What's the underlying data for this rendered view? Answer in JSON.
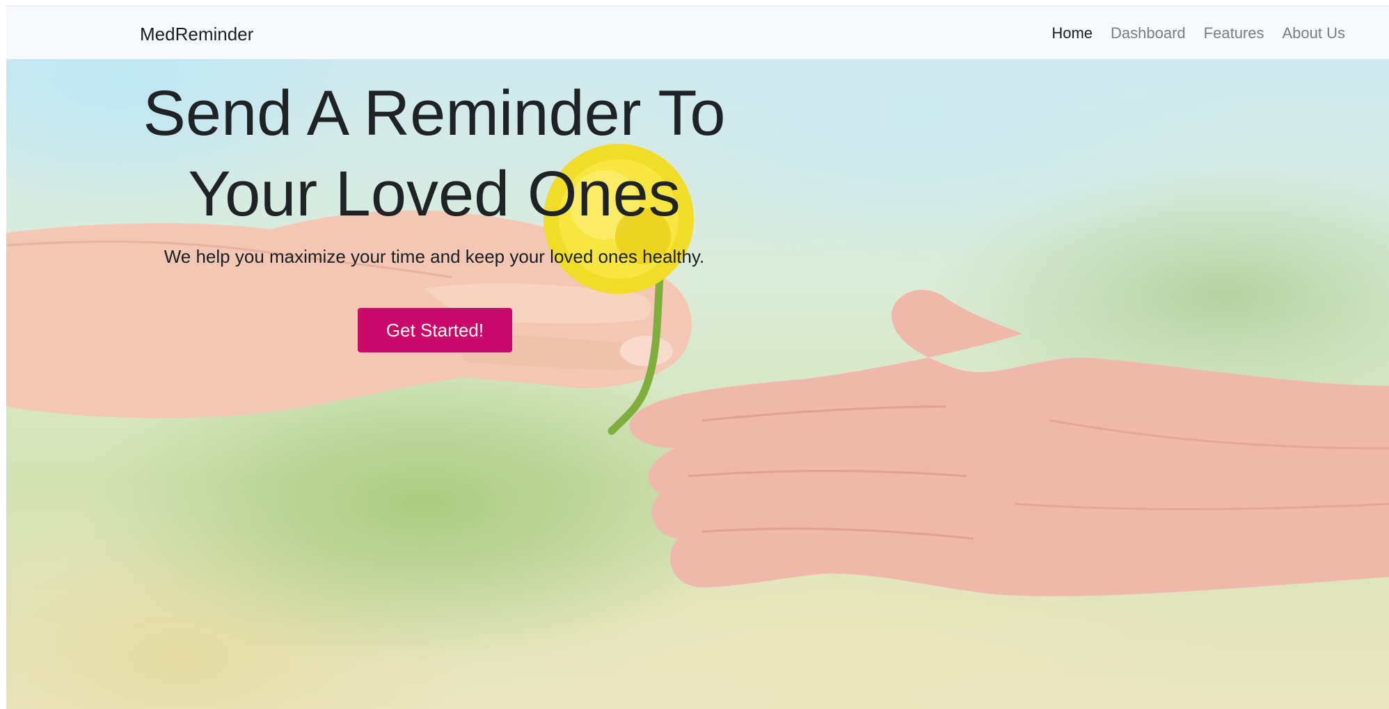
{
  "navbar": {
    "brand": "MedReminder",
    "links": [
      {
        "label": "Home",
        "active": true
      },
      {
        "label": "Dashboard",
        "active": false
      },
      {
        "label": "Features",
        "active": false
      },
      {
        "label": "About Us",
        "active": false
      }
    ]
  },
  "hero": {
    "title_line_1": "Send A Reminder To",
    "title_line_2": "Your Loved Ones",
    "subtitle": "We help you maximize your time and keep your loved ones healthy.",
    "cta_label": "Get Started!",
    "background_image": "young hand handing a yellow dandelion to an elderly hand"
  },
  "colors": {
    "navbar_bg": "#f8f9fa",
    "nav_active": "#1b1e21",
    "nav_inactive": "#7a7d80",
    "cta_bg": "#c8096a",
    "cta_text": "#ffffff",
    "headline": "#1f2326"
  }
}
